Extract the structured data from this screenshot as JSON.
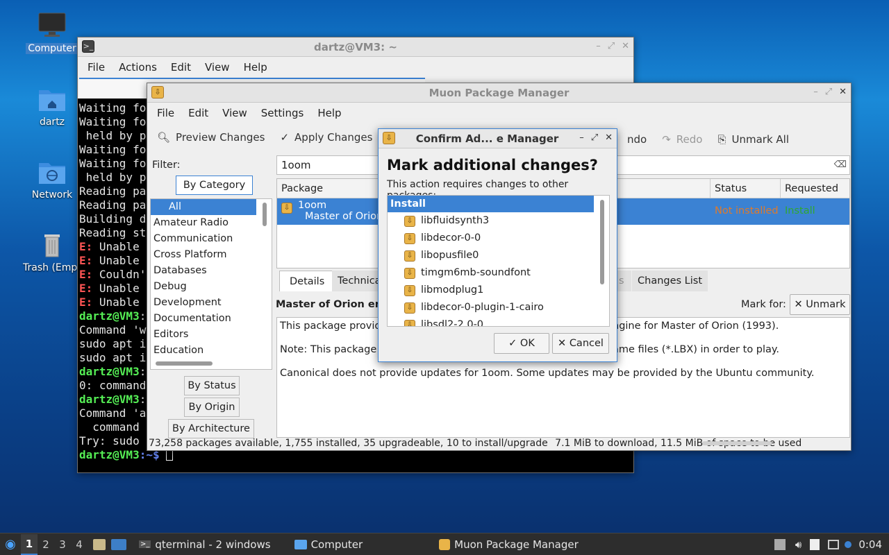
{
  "desktop": {
    "icons": [
      {
        "label": "Computer"
      },
      {
        "label": "dartz"
      },
      {
        "label": "Network"
      },
      {
        "label": "Trash (Empty)"
      }
    ]
  },
  "terminal": {
    "title": "dartz@VM3: ~",
    "menu": [
      "File",
      "Actions",
      "Edit",
      "View",
      "Help"
    ],
    "lines": [
      {
        "pre": "",
        "text": "Waiting fo"
      },
      {
        "pre": "",
        "text": "Waiting fo"
      },
      {
        "pre": "",
        "text": " held by p"
      },
      {
        "pre": "",
        "text": "Waiting fo"
      },
      {
        "pre": "",
        "text": "Waiting fo"
      },
      {
        "pre": "",
        "text": " held by p"
      },
      {
        "pre": "",
        "text": "Reading pa"
      },
      {
        "pre": "",
        "text": "Reading pa"
      },
      {
        "pre": "",
        "text": "Building d"
      },
      {
        "pre": "",
        "text": "Reading st"
      },
      {
        "pre": "E:",
        "text": " Unable"
      },
      {
        "pre": "E:",
        "text": " Unable"
      },
      {
        "pre": "E:",
        "text": " Couldn'"
      },
      {
        "pre": "E:",
        "text": " Unable"
      },
      {
        "pre": "E:",
        "text": " Unable"
      },
      {
        "prompt": "dartz@VM3",
        "text": ":"
      },
      {
        "pre": "",
        "text": "Command 'w"
      },
      {
        "pre": "",
        "text": "sudo apt i"
      },
      {
        "pre": "",
        "text": "sudo apt i"
      },
      {
        "prompt": "dartz@VM3",
        "text": ":"
      },
      {
        "pre": "",
        "text": "0: command"
      },
      {
        "prompt": "dartz@VM3",
        "text": ":"
      },
      {
        "pre": "",
        "text": "Command 'a"
      },
      {
        "pre": "",
        "text": "  command"
      },
      {
        "pre": "",
        "text": "Try: sudo"
      }
    ],
    "last_prompt_user": "dartz@VM3",
    "last_prompt_path": ":~$ "
  },
  "muon": {
    "title": "Muon Package Manager",
    "menu": [
      "File",
      "Edit",
      "View",
      "Settings",
      "Help"
    ],
    "toolbar": {
      "preview": "Preview Changes",
      "apply": "Apply Changes",
      "undo": "ndo",
      "redo": "Redo",
      "unmark_all": "Unmark All"
    },
    "filter_label": "Filter:",
    "search_value": "1oom",
    "tabs": {
      "category": "By Category",
      "status": "By Status",
      "origin": "By Origin",
      "architecture": "By Architecture"
    },
    "categories": [
      "All",
      "Amateur Radio",
      "Communication",
      "Cross Platform",
      "Databases",
      "Debug",
      "Development",
      "Documentation",
      "Editors",
      "Education"
    ],
    "columns": {
      "package": "Package",
      "status": "Status",
      "requested": "Requested"
    },
    "selected_row": {
      "name": "1oom",
      "summary": "Master of Orion",
      "status": "Not installed",
      "requested": "Install"
    },
    "detail_tabs": {
      "details": "Details",
      "technical": "Technica",
      "partial": "s",
      "changes": "Changes List"
    },
    "detail_heading": "Master of Orion engi",
    "mark_for": "Mark for:",
    "unmark": "Unmark",
    "description": [
      "This package provide",
      "ngine for Master of Orion (1993).",
      "Note: This package o",
      "ame files (*.LBX) in order to play.",
      "Canonical does not provide updates for 1oom. Some updates may be provided by the Ubuntu community."
    ],
    "statusbar": "73,258 packages available, 1,755 installed, 35 upgradeable, 10 to install/upgrade",
    "statusbar_download": "7.1 MiB to download, 11.5 MiB of space to be used"
  },
  "dialog": {
    "title": "Confirm Ad... e Manager",
    "heading": "Mark additional changes?",
    "subtext": "This action requires changes to other packages:",
    "group": "Install",
    "items": [
      "libfluidsynth3",
      "libdecor-0-0",
      "libopusfile0",
      "timgm6mb-soundfont",
      "libmodplug1",
      "libdecor-0-plugin-1-cairo",
      "libsdl2-2.0-0"
    ],
    "ok": "OK",
    "cancel": "Cancel"
  },
  "taskbar": {
    "workspaces": [
      "1",
      "2",
      "3",
      "4"
    ],
    "tasks": [
      {
        "label": "qterminal - 2 windows"
      },
      {
        "label": "Computer"
      },
      {
        "label": "Muon Package Manager"
      }
    ],
    "clock": "0:04"
  },
  "colors": {
    "accent": "#3b82d3",
    "not_installed": "#e07a2a",
    "install": "#2fa82f"
  }
}
